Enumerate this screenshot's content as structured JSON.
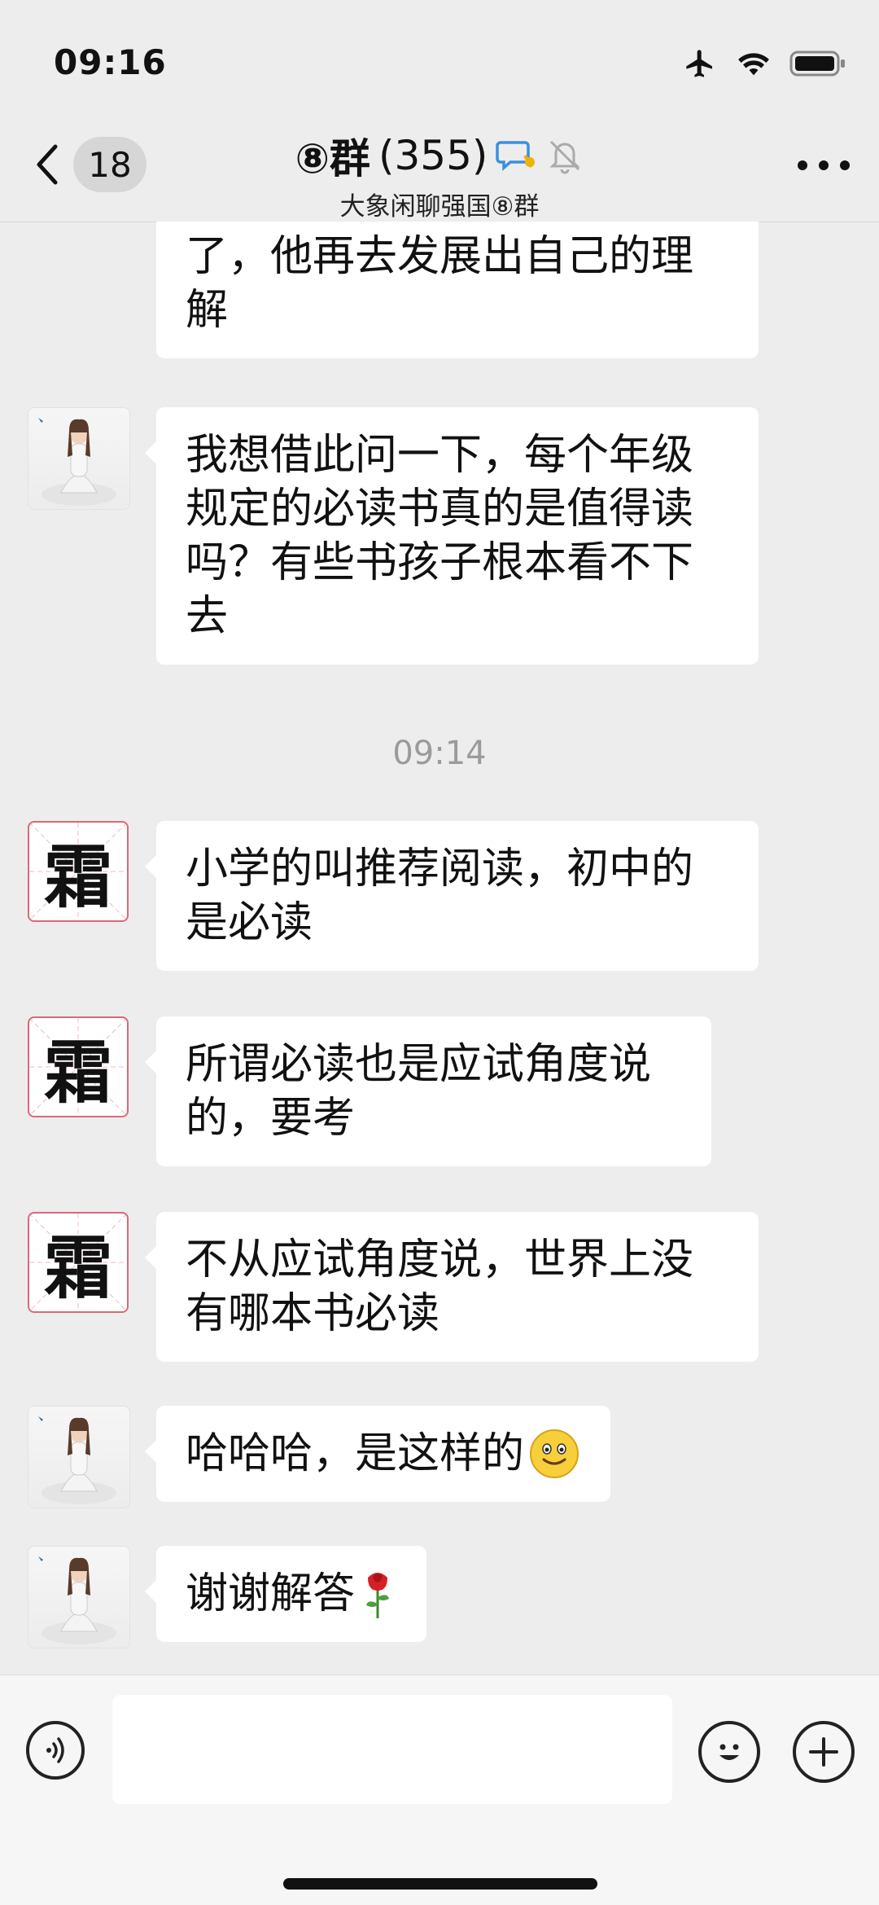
{
  "status_bar": {
    "time": "09:16"
  },
  "header": {
    "unread_count": "18",
    "title": "⑧群",
    "member_count": "(355)",
    "subtitle": "大象闲聊强国⑧群"
  },
  "messages": [
    {
      "sender": "prev",
      "text": "了，他再去发展出自己的理解"
    },
    {
      "sender": "girl",
      "text": "我想借此问一下，每个年级规定的必读书真的是值得读吗？有些书孩子根本看不下去"
    },
    {
      "type": "time",
      "text": "09:14"
    },
    {
      "sender": "shuang",
      "text": "小学的叫推荐阅读，初中的是必读"
    },
    {
      "sender": "shuang",
      "text": "所谓必读也是应试角度说的，要考"
    },
    {
      "sender": "shuang",
      "text": "不从应试角度说，世界上没有哪本书必读"
    },
    {
      "sender": "girl",
      "text": "哈哈哈，是这样的",
      "emoji": "smile"
    },
    {
      "sender": "girl",
      "text": "谢谢解答",
      "emoji": "rose"
    }
  ],
  "avatars": {
    "shuang_char": "霜"
  },
  "input_bar": {
    "value": ""
  },
  "colors": {
    "background": "#ededed",
    "bubble": "#ffffff",
    "avatar_border": "#d86a78"
  }
}
